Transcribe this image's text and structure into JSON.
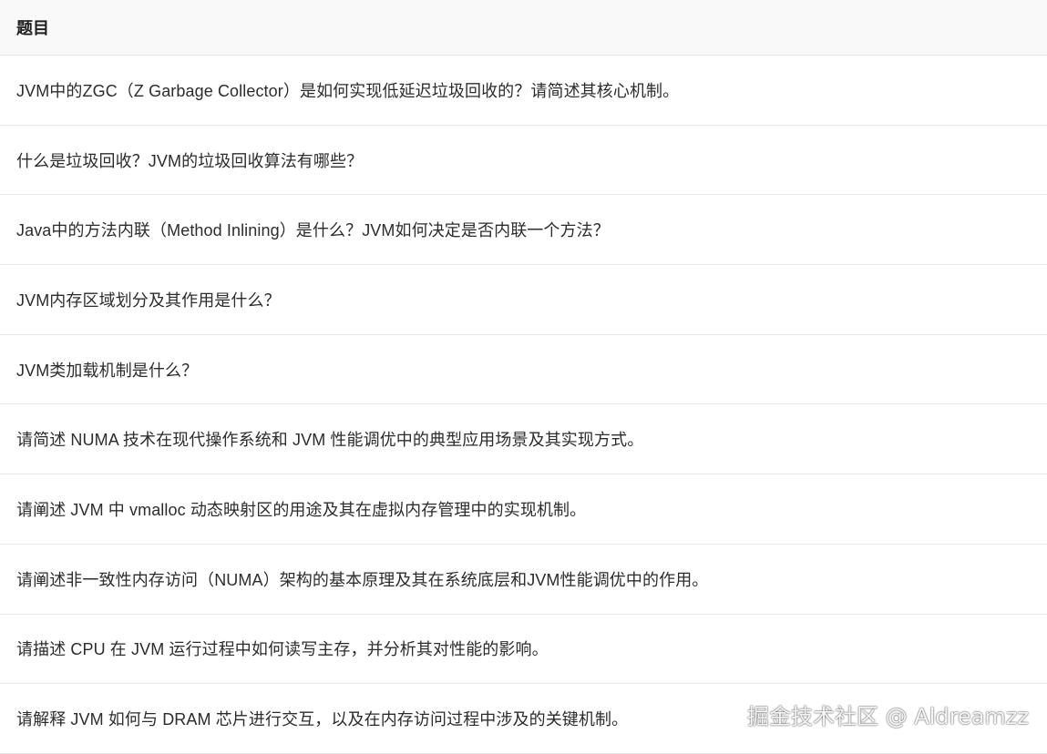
{
  "table": {
    "header": "题目",
    "rows": [
      "JVM中的ZGC（Z Garbage Collector）是如何实现低延迟垃圾回收的？请简述其核心机制。",
      "什么是垃圾回收？JVM的垃圾回收算法有哪些？",
      "Java中的方法内联（Method Inlining）是什么？JVM如何决定是否内联一个方法？",
      "JVM内存区域划分及其作用是什么？",
      "JVM类加载机制是什么？",
      "请简述 NUMA 技术在现代操作系统和 JVM 性能调优中的典型应用场景及其实现方式。",
      "请阐述 JVM 中 vmalloc 动态映射区的用途及其在虚拟内存管理中的实现机制。",
      "请阐述非一致性内存访问（NUMA）架构的基本原理及其在系统底层和JVM性能调优中的作用。",
      "请描述 CPU 在 JVM 运行过程中如何读写主存，并分析其对性能的影响。",
      "请解释 JVM 如何与 DRAM 芯片进行交互，以及在内存访问过程中涉及的关键机制。"
    ]
  },
  "watermark": "掘金技术社区 @ Aldreamzz"
}
